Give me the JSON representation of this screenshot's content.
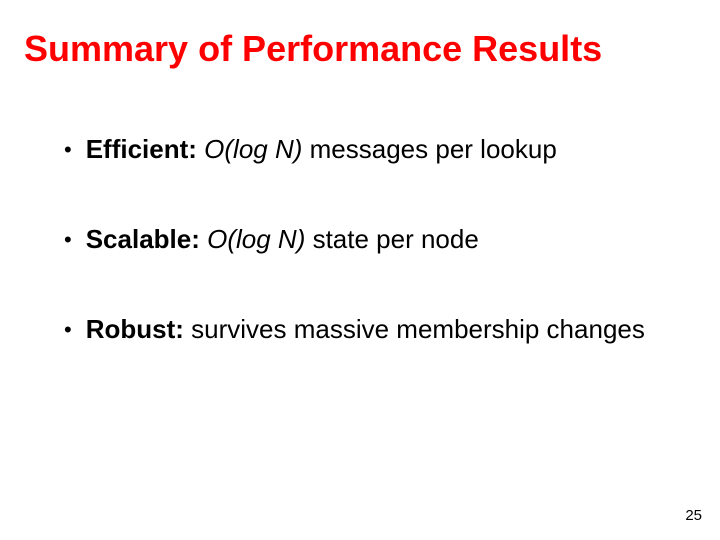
{
  "slide": {
    "title": "Summary of Performance Results",
    "bullets": [
      {
        "label": "Efficient:",
        "complexity": "O(log N)",
        "description": " messages per lookup"
      },
      {
        "label": "Scalable:",
        "complexity": "O(log N)",
        "description": " state per node"
      },
      {
        "label": "Robust:",
        "complexity": "",
        "description": " survives massive membership changes"
      }
    ],
    "page_number": "25"
  }
}
